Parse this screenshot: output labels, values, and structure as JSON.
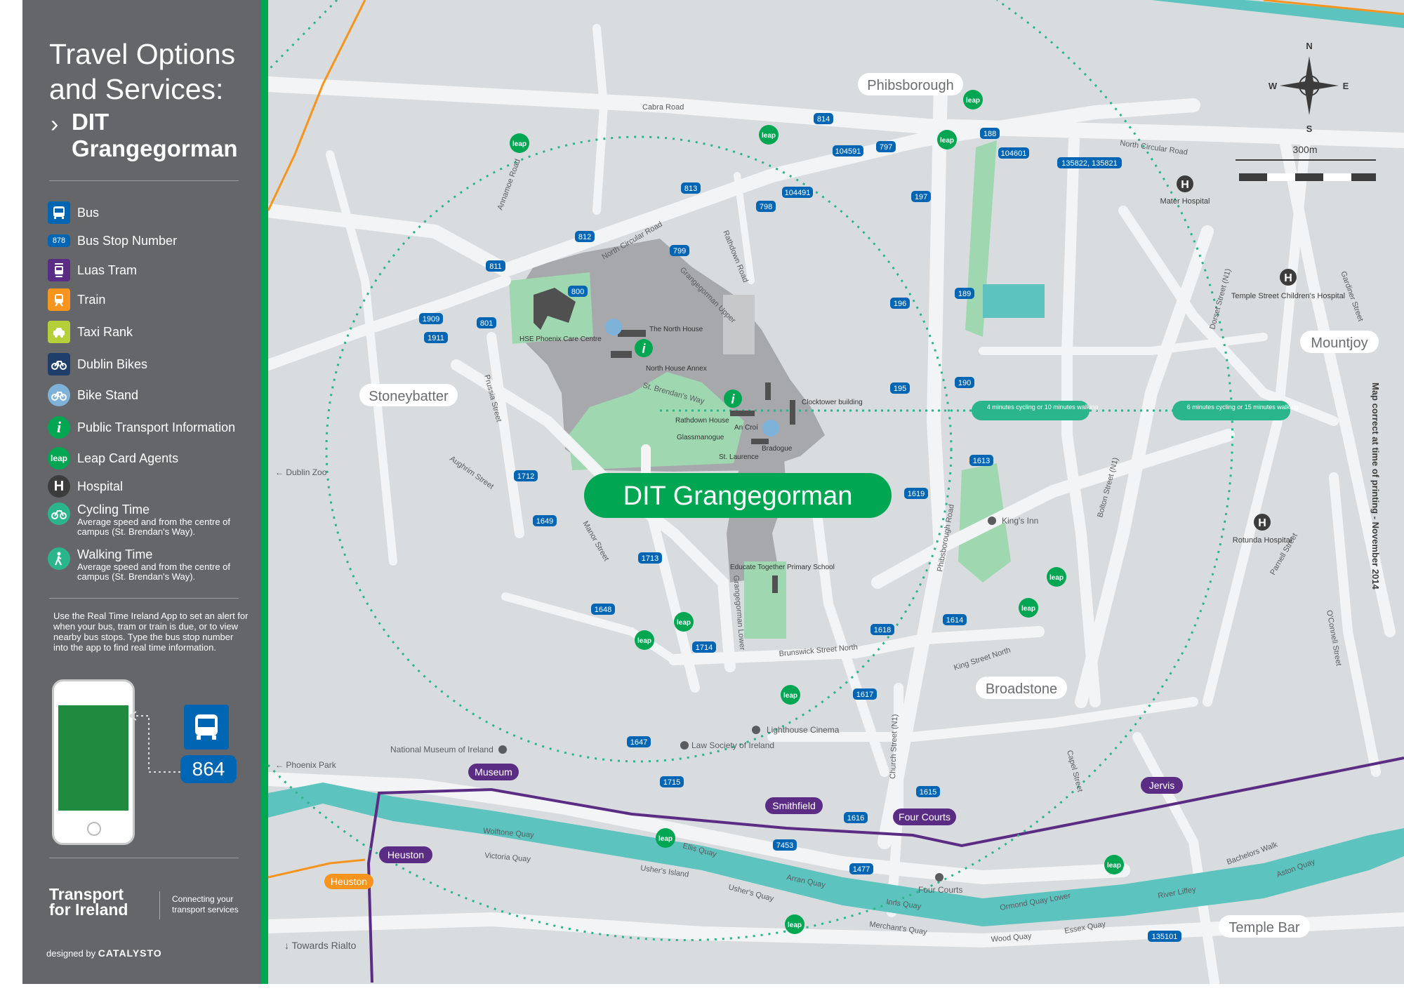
{
  "sidebar": {
    "title_line1": "Travel Options",
    "title_line2": "and Services:",
    "subtitle_line1": "DIT",
    "subtitle_line2": "Grangegorman",
    "legend": [
      {
        "label": "Bus"
      },
      {
        "label": "Bus Stop Number",
        "badge": "878"
      },
      {
        "label": "Luas Tram"
      },
      {
        "label": "Train"
      },
      {
        "label": "Taxi Rank"
      },
      {
        "label": "Dublin Bikes"
      },
      {
        "label": "Bike Stand"
      },
      {
        "label": "Public Transport Information"
      },
      {
        "label": "Leap Card Agents"
      },
      {
        "label": "Hospital"
      },
      {
        "label": "Cycling Time",
        "sub": "Average speed and from the centre of campus (St. Brendan's Way)."
      },
      {
        "label": "Walking Time",
        "sub": "Average speed and from the centre of campus (St. Brendan's Way)."
      }
    ],
    "info_text": "Use the Real Time Ireland App to set an alert for when your bus, tram or train is due, or to view nearby bus stops. Type the bus stop number into the app to find real time information.",
    "example_stop": "864",
    "tfi_line1": "Transport",
    "tfi_line2": "for Ireland",
    "tfi_tag": "Connecting your transport services",
    "designed_by": "designed by",
    "designer": "CATALYSTO"
  },
  "map": {
    "title": "DIT Grangegorman",
    "note": "Map correct at time of printing - November 2014",
    "scale_label": "300m",
    "compass": {
      "n": "N",
      "s": "S",
      "e": "E",
      "w": "W"
    },
    "areas": [
      "Phibsborough",
      "Stoneybatter",
      "Mountjoy",
      "Broadstone",
      "Temple Bar"
    ],
    "streets": [
      "Cabra Road",
      "North Circular Road",
      "Annamoe Road",
      "Rathdown Road",
      "Grangegorman Upper",
      "Prussia Street",
      "Aughrim Street",
      "Manor Street",
      "Grangegorman Lower",
      "Brunswick Street North",
      "King Street North",
      "Phibsborough Road",
      "Church Street (N1)",
      "Dorset Street (N1)",
      "Bolton Street (N1)",
      "Gardiner Street",
      "Parnell Street",
      "O'Connell Street",
      "Capel Street",
      "Wolftone Quay",
      "Victoria Quay",
      "Usher's Island",
      "Ellis Quay",
      "Usher's Quay",
      "Arran Quay",
      "Inns Quay",
      "Merchant's Quay",
      "Ormond Quay Lower",
      "Wood Quay",
      "Essex Quay",
      "Bachelors Walk",
      "Aston Quay",
      "River Liffey",
      "St. Brendan's Way"
    ],
    "places": [
      "HSE Phoenix Care Centre",
      "The North House",
      "North House Annex",
      "Clocktower building",
      "Rathdown House",
      "An Croí",
      "Glassmanogue",
      "Bradogue",
      "St. Laurence",
      "Educate Together Primary School",
      "King's Inn",
      "Lighthouse Cinema",
      "Law Society of Ireland",
      "National Museum of Ireland",
      "Four Courts",
      "Mater Hospital",
      "Temple Street Children's Hospital",
      "Rotunda Hospital"
    ],
    "directions": [
      "Dublin Zoo",
      "Phoenix Park",
      "Towards Rialto"
    ],
    "luas_stops": [
      "Museum",
      "Heuston",
      "Smithfield",
      "Four Courts",
      "Jervis"
    ],
    "train_stop": "Heuston",
    "travel_times": [
      "4 minutes cycling or 10 minutes walking",
      "6 minutes cycling or 15 minutes walking"
    ],
    "bus_stops": [
      "814",
      "104591",
      "797",
      "188",
      "104601",
      "135822, 135821",
      "813",
      "104491",
      "798",
      "197",
      "812",
      "799",
      "811",
      "800",
      "1909",
      "801",
      "1911",
      "196",
      "189",
      "195",
      "190",
      "1613",
      "1619",
      "1712",
      "1649",
      "1713",
      "1648",
      "1714",
      "1618",
      "1614",
      "1617",
      "1647",
      "1715",
      "7453",
      "1615",
      "1616",
      "1477",
      "135101"
    ]
  }
}
